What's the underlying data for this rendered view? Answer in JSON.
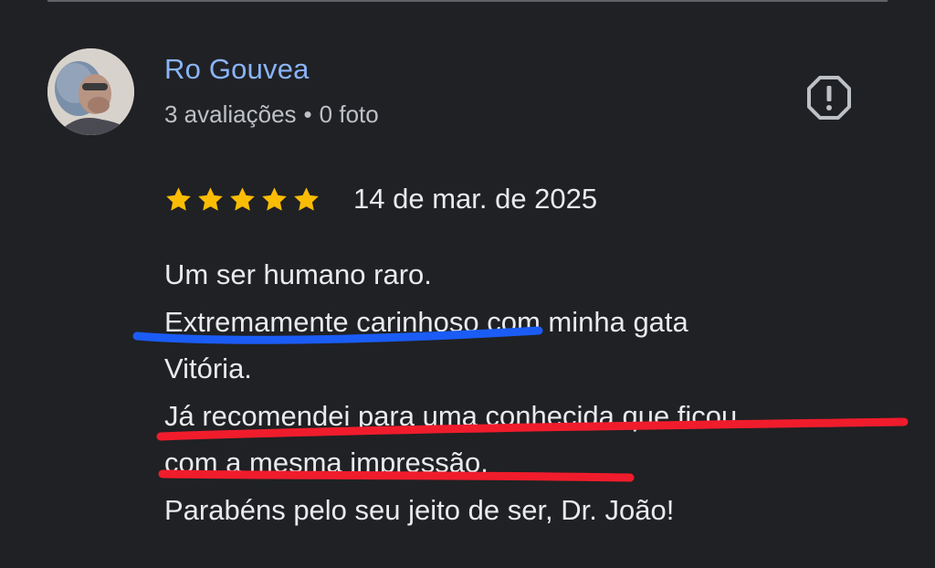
{
  "reviewer": {
    "name": "Ro Gouvea",
    "reviews_count": "3 avaliações",
    "separator": "•",
    "photos_count": "0 foto"
  },
  "review": {
    "rating": 5,
    "date": "14 de mar. de 2025",
    "lines": [
      "Um ser humano raro.",
      "Extremamente carinhoso com minha gata",
      "Vitória.",
      "Já recomendei para uma conhecida que ficou",
      "com a mesma impressão.",
      "Parabéns pelo seu jeito de ser, Dr. João!"
    ]
  },
  "icons": {
    "report": "report-flag-icon",
    "star": "star-icon",
    "star_color": "#fbbc04"
  },
  "colors": {
    "background": "#202124",
    "name": "#8ab4f8",
    "underline_blue": "#1a5cf5",
    "underline_red": "#f01c2c"
  }
}
